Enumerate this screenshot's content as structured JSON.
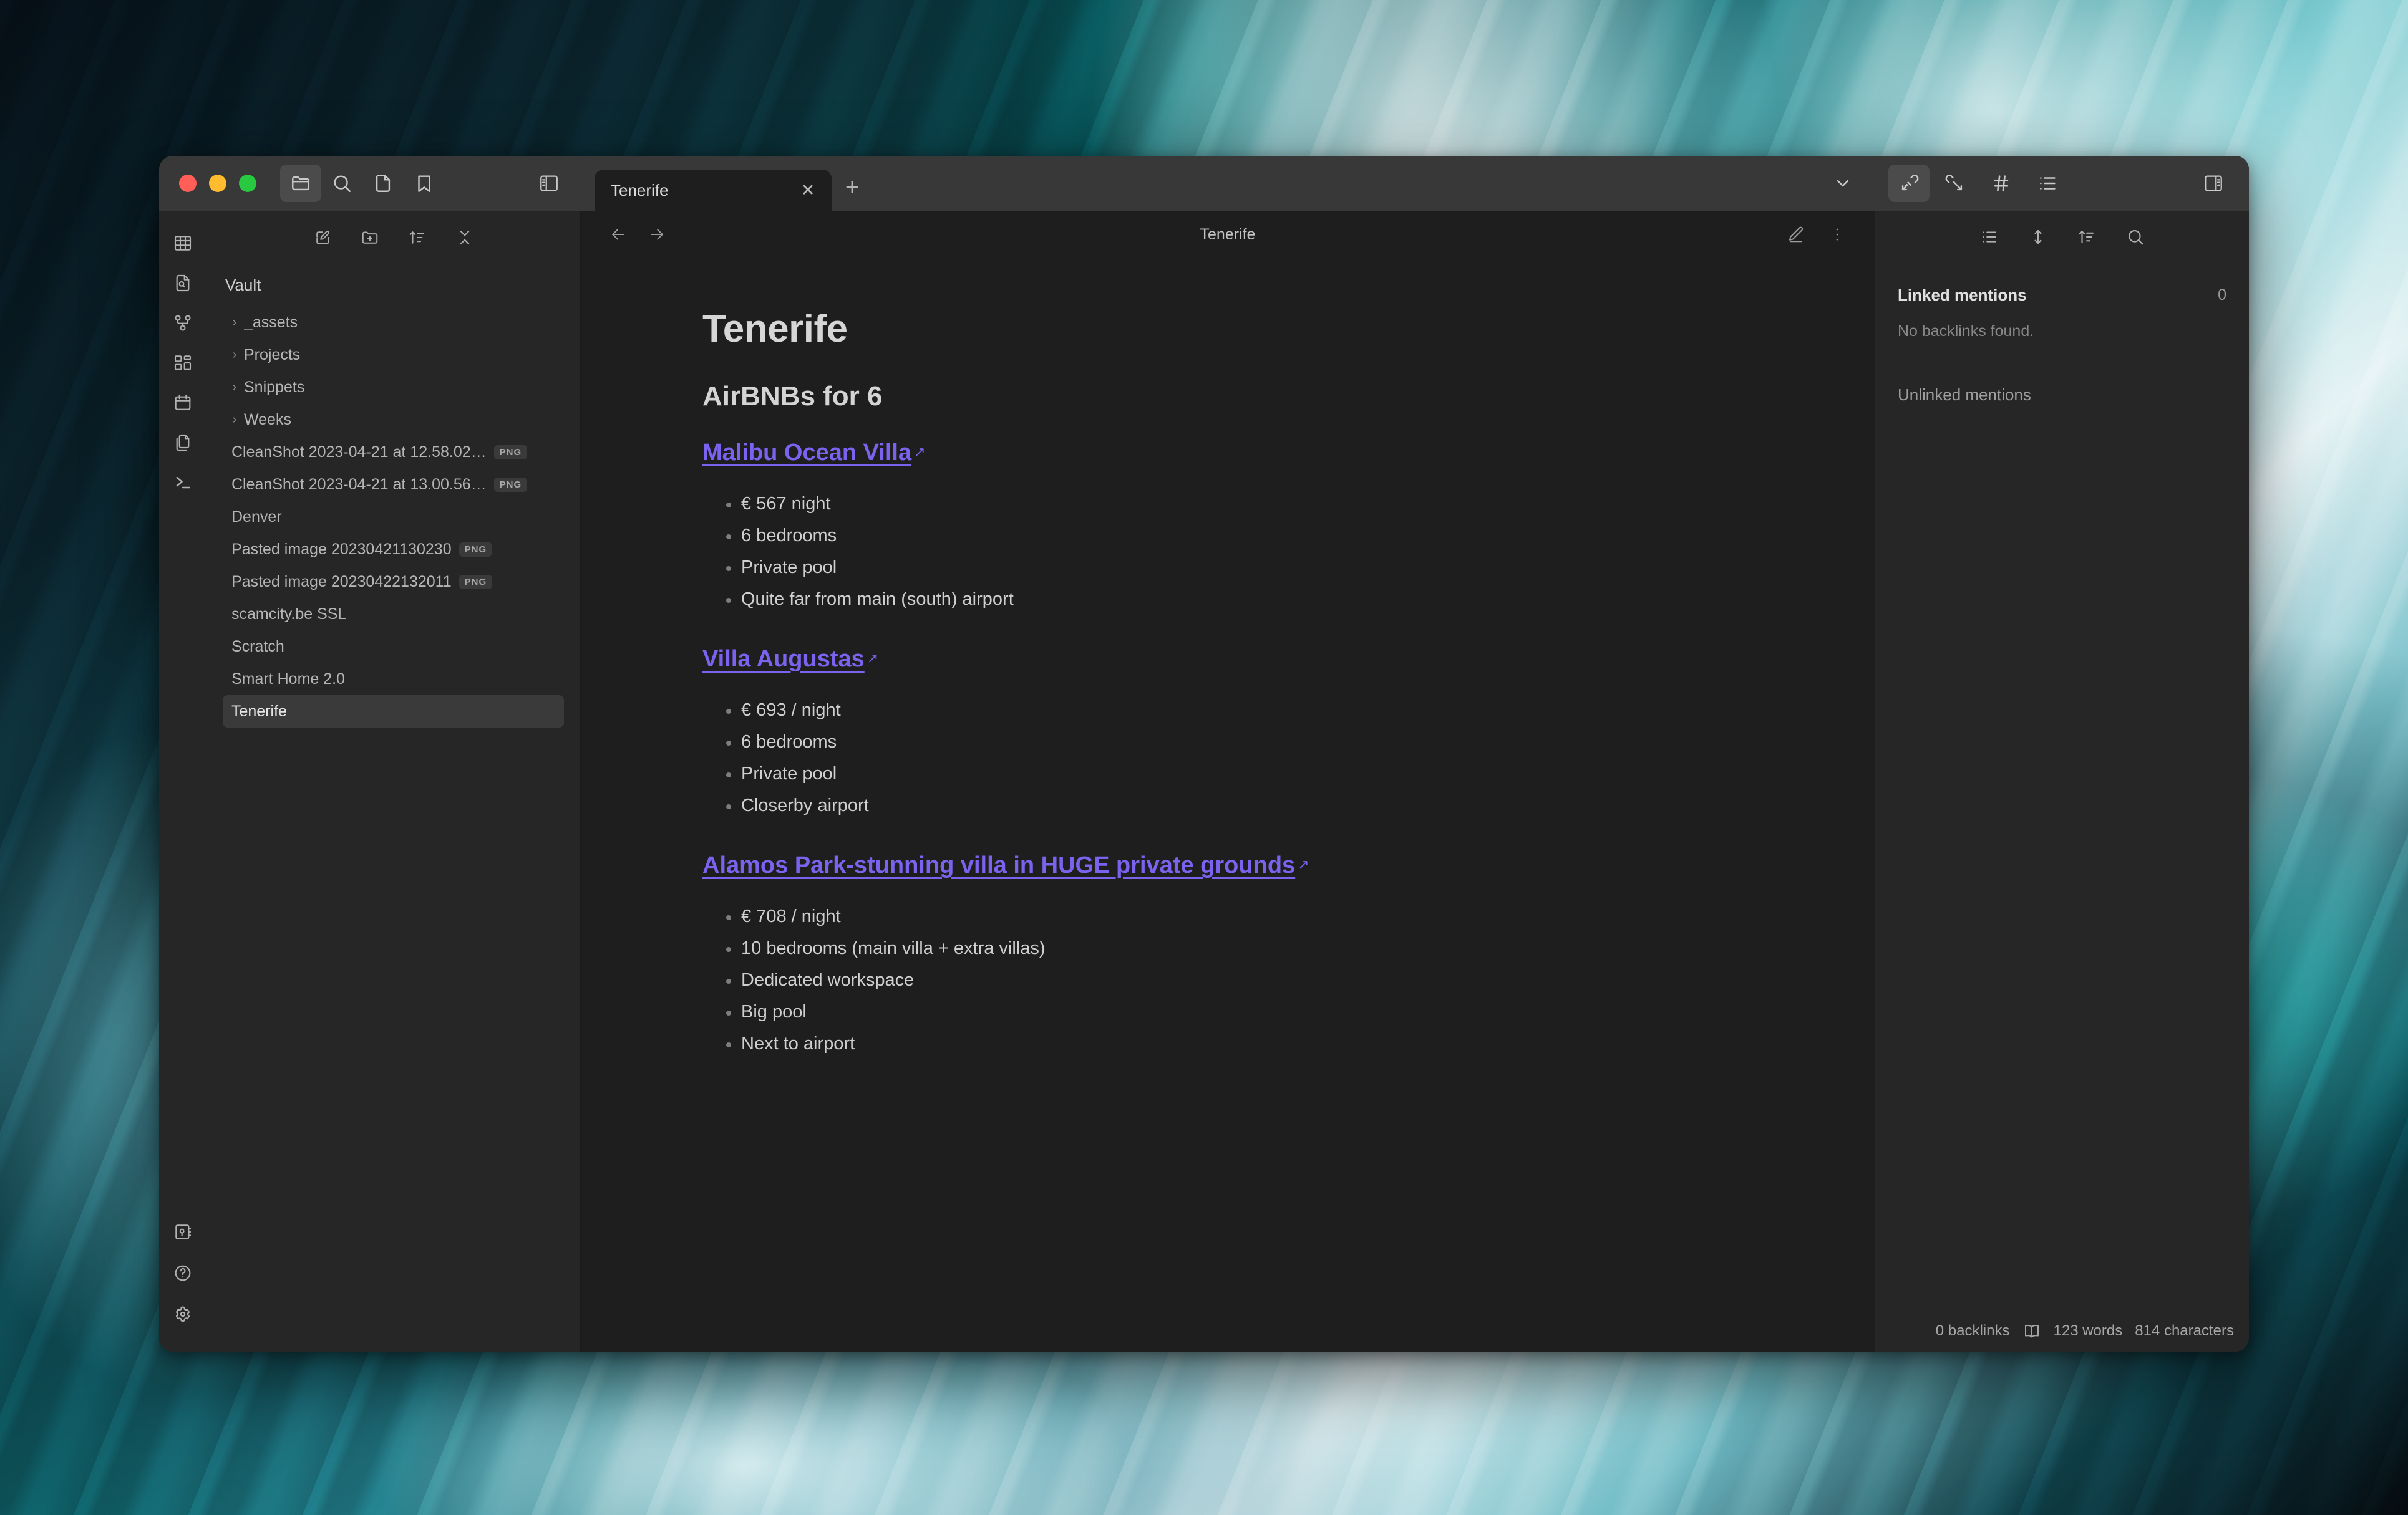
{
  "window": {
    "traffic_lights": [
      "close",
      "minimize",
      "maximize"
    ]
  },
  "titlebar": {
    "buttons": [
      {
        "name": "folder-icon",
        "label": "Files",
        "active": true
      },
      {
        "name": "search-icon",
        "label": "Search",
        "active": false
      },
      {
        "name": "file-icon",
        "label": "Quick switcher",
        "active": false
      },
      {
        "name": "bookmark-icon",
        "label": "Bookmarks",
        "active": false
      }
    ],
    "left_sidebar_toggle": "left-sidebar-toggle-icon",
    "right_sidebar_toggle": "right-sidebar-toggle-icon",
    "tab_dropdown": "chevron-down-icon",
    "right_buttons": [
      {
        "name": "backlinks-icon",
        "label": "Backlinks",
        "active": true
      },
      {
        "name": "outgoing-links-icon",
        "label": "Outgoing links",
        "active": false
      },
      {
        "name": "tags-icon",
        "label": "Tags",
        "active": false
      },
      {
        "name": "outline-icon",
        "label": "Outline",
        "active": false
      }
    ]
  },
  "tabs": [
    {
      "label": "Tenerife",
      "close": "✕",
      "active": true
    }
  ],
  "new_tab_label": "+",
  "ribbon": {
    "icons": [
      {
        "name": "table-icon",
        "label": "Open table view"
      },
      {
        "name": "file-search-icon",
        "label": "Search in file"
      },
      {
        "name": "graph-icon",
        "label": "Open graph view"
      },
      {
        "name": "canvas-icon",
        "label": "Create new canvas"
      },
      {
        "name": "calendar-icon",
        "label": "Open calendar"
      },
      {
        "name": "copy-icon",
        "label": "Open templates"
      },
      {
        "name": "terminal-icon",
        "label": "Open terminal"
      }
    ],
    "bottom_icons": [
      {
        "name": "vault-icon",
        "label": "Open another vault"
      },
      {
        "name": "help-icon",
        "label": "Help"
      },
      {
        "name": "settings-icon",
        "label": "Settings"
      }
    ]
  },
  "explorer": {
    "toolbar": [
      {
        "name": "new-note-icon",
        "label": "New note"
      },
      {
        "name": "new-folder-icon",
        "label": "New folder"
      },
      {
        "name": "sort-icon",
        "label": "Change sort order"
      },
      {
        "name": "collapse-icon",
        "label": "Collapse all"
      }
    ],
    "vault_title": "Vault",
    "folders": [
      {
        "label": "_assets",
        "expanded": false
      },
      {
        "label": "Projects",
        "expanded": false
      },
      {
        "label": "Snippets",
        "expanded": false
      },
      {
        "label": "Weeks",
        "expanded": false
      }
    ],
    "files": [
      {
        "label": "CleanShot 2023-04-21 at 12.58.02…",
        "badge": "PNG",
        "selected": false
      },
      {
        "label": "CleanShot 2023-04-21 at 13.00.56…",
        "badge": "PNG",
        "selected": false
      },
      {
        "label": "Denver",
        "badge": "",
        "selected": false
      },
      {
        "label": "Pasted image 20230421130230",
        "badge": "PNG",
        "selected": false
      },
      {
        "label": "Pasted image 20230422132011",
        "badge": "PNG",
        "selected": false
      },
      {
        "label": "scamcity.be SSL",
        "badge": "",
        "selected": false
      },
      {
        "label": "Scratch",
        "badge": "",
        "selected": false
      },
      {
        "label": "Smart Home 2.0",
        "badge": "",
        "selected": false
      },
      {
        "label": "Tenerife",
        "badge": "",
        "selected": true
      }
    ]
  },
  "editor": {
    "nav_back": "back-icon",
    "nav_forward": "forward-icon",
    "title": "Tenerife",
    "edit_icon": "edit-pencil-icon",
    "more_icon": "more-options-icon",
    "note": {
      "h1": "Tenerife",
      "h2": "AirBNBs for 6",
      "sections": [
        {
          "link": "Malibu Ocean Villa",
          "external_icon": "external-link-icon",
          "bullets": [
            "€ 567 night",
            "6 bedrooms",
            "Private pool",
            "Quite far from main (south) airport"
          ]
        },
        {
          "link": "Villa Augustas",
          "external_icon": "external-link-icon",
          "bullets": [
            "€ 693 / night",
            "6 bedrooms",
            "Private pool",
            "Closerby airport"
          ]
        },
        {
          "link": "Alamos Park-stunning villa in HUGE private grounds",
          "external_icon": "external-link-icon",
          "bullets": [
            "€ 708 / night",
            "10 bedrooms (main villa + extra villas)",
            "Dedicated workspace",
            "Big pool",
            "Next to airport"
          ]
        }
      ]
    }
  },
  "rightpane": {
    "toolbar": [
      {
        "name": "collapse-results-icon",
        "label": "Collapse results"
      },
      {
        "name": "show-more-context-icon",
        "label": "Show more context"
      },
      {
        "name": "change-sort-order-icon",
        "label": "Change sort order"
      },
      {
        "name": "search-backlinks-icon",
        "label": "Search backlinks"
      }
    ],
    "linked_mentions_title": "Linked mentions",
    "linked_mentions_count": "0",
    "no_backlinks": "No backlinks found.",
    "unlinked_mentions_title": "Unlinked mentions"
  },
  "statusbar": {
    "backlinks": "0 backlinks",
    "reading_icon": "book-icon",
    "words": "123 words",
    "characters": "814 characters"
  },
  "colors": {
    "link": "#7b63f0",
    "titlebar": "#383838",
    "sidebar": "#262626",
    "editor_bg": "#1e1e1e",
    "selected_row": "#3a3a3a"
  }
}
